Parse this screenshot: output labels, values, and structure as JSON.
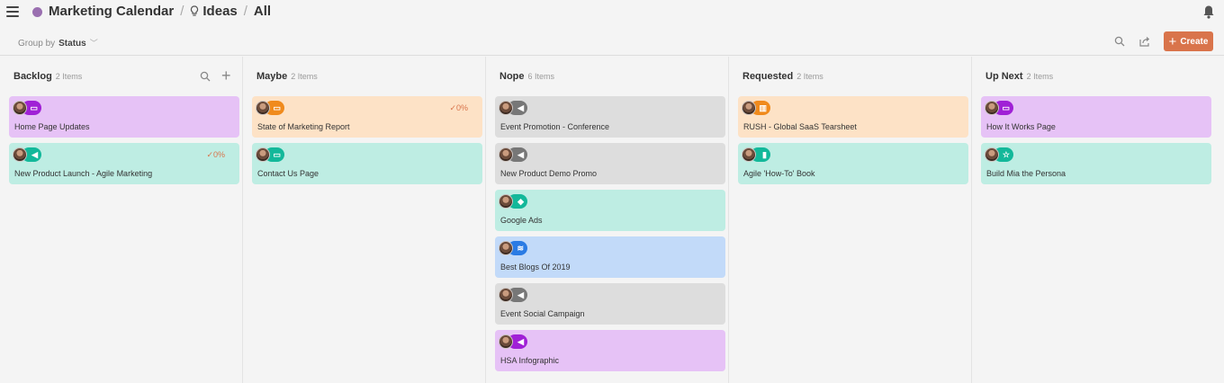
{
  "header": {
    "crumb_1": "Marketing Calendar",
    "crumb_2": "Ideas",
    "crumb_3": "All",
    "separator": "/"
  },
  "toolbar": {
    "group_by_label": "Group by",
    "group_by_value": "Status",
    "create_label": "Create",
    "create_plus": "+"
  },
  "colors": {
    "accent": "#d9744b",
    "card_purple": "#e6c2f6",
    "card_peach": "#fde2c6",
    "card_teal": "#beede3",
    "card_gray": "#dddddd",
    "card_blue": "#c2daf9",
    "icon_purple": "#a020d6",
    "icon_orange": "#f08a1c",
    "icon_teal": "#13b89a",
    "icon_gray": "#777777",
    "icon_blue": "#2a7be4"
  },
  "columns": [
    {
      "name": "Backlog",
      "count": "2 Items",
      "cards": [
        {
          "title": "Home Page Updates",
          "bg": "#e6c2f6",
          "icon_color": "#a020d6",
          "icon_glyph": "▭",
          "icon_name": "screen-icon",
          "progress": ""
        },
        {
          "title": "New Product Launch - Agile Marketing",
          "bg": "#beede3",
          "icon_color": "#13b89a",
          "icon_glyph": "◀",
          "icon_name": "megaphone-icon",
          "progress": "✓0%"
        }
      ]
    },
    {
      "name": "Maybe",
      "count": "2 Items",
      "cards": [
        {
          "title": "State of Marketing Report",
          "bg": "#fde2c6",
          "icon_color": "#f08a1c",
          "icon_glyph": "▭",
          "icon_name": "screen-icon",
          "progress": "✓0%"
        },
        {
          "title": "Contact Us Page",
          "bg": "#beede3",
          "icon_color": "#13b89a",
          "icon_glyph": "▭",
          "icon_name": "screen-icon",
          "progress": ""
        }
      ]
    },
    {
      "name": "Nope",
      "count": "6 Items",
      "cards": [
        {
          "title": "Event Promotion - Conference",
          "bg": "#dddddd",
          "icon_color": "#777777",
          "icon_glyph": "◀",
          "icon_name": "megaphone-icon",
          "progress": ""
        },
        {
          "title": "New Product Demo Promo",
          "bg": "#dddddd",
          "icon_color": "#777777",
          "icon_glyph": "◀",
          "icon_name": "megaphone-icon",
          "progress": ""
        },
        {
          "title": "Google Ads",
          "bg": "#beede3",
          "icon_color": "#13b89a",
          "icon_glyph": "◆",
          "icon_name": "tag-icon",
          "progress": ""
        },
        {
          "title": "Best Blogs Of 2019",
          "bg": "#c2daf9",
          "icon_color": "#2a7be4",
          "icon_glyph": "≋",
          "icon_name": "rss-icon",
          "progress": ""
        },
        {
          "title": "Event Social Campaign",
          "bg": "#dddddd",
          "icon_color": "#777777",
          "icon_glyph": "◀",
          "icon_name": "megaphone-icon",
          "progress": ""
        },
        {
          "title": "HSA Infographic",
          "bg": "#e6c2f6",
          "icon_color": "#a020d6",
          "icon_glyph": "◀",
          "icon_name": "megaphone-icon",
          "progress": ""
        }
      ]
    },
    {
      "name": "Requested",
      "count": "2 Items",
      "cards": [
        {
          "title": "RUSH - Global SaaS Tearsheet",
          "bg": "#fde2c6",
          "icon_color": "#f08a1c",
          "icon_glyph": "▥",
          "icon_name": "document-icon",
          "progress": ""
        },
        {
          "title": "Agile 'How-To' Book",
          "bg": "#beede3",
          "icon_color": "#13b89a",
          "icon_glyph": "▮",
          "icon_name": "book-icon",
          "progress": ""
        }
      ]
    },
    {
      "name": "Up Next",
      "count": "2 Items",
      "cards": [
        {
          "title": "How It Works Page",
          "bg": "#e6c2f6",
          "icon_color": "#a020d6",
          "icon_glyph": "▭",
          "icon_name": "screen-icon",
          "progress": ""
        },
        {
          "title": "Build Mia the Persona",
          "bg": "#beede3",
          "icon_color": "#13b89a",
          "icon_glyph": "☆",
          "icon_name": "star-icon",
          "progress": ""
        }
      ]
    }
  ]
}
